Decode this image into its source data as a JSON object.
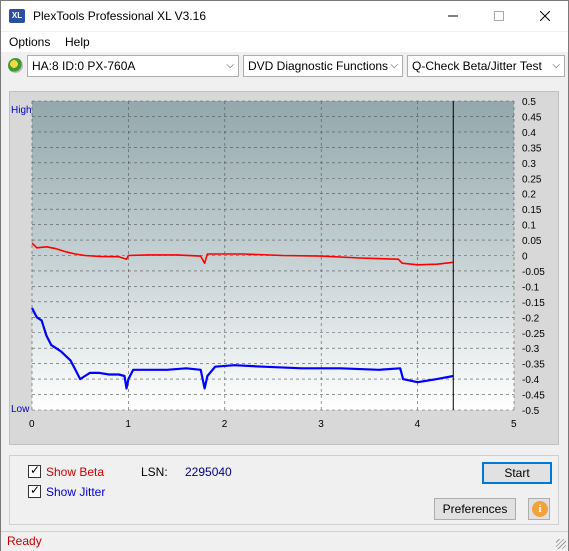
{
  "window": {
    "title": "PlexTools Professional XL V3.16",
    "icon_label": "XL",
    "minimize_icon": "minimize-icon",
    "maximize_icon": "maximize-icon",
    "close_icon": "close-icon"
  },
  "menu": {
    "options": "Options",
    "help": "Help"
  },
  "toolbar": {
    "drive": "HA:8 ID:0  PX-760A",
    "function": "DVD Diagnostic Functions",
    "test": "Q-Check Beta/Jitter Test"
  },
  "chart_data": {
    "type": "line",
    "title": "",
    "xlabel": "",
    "ylabel": "",
    "xlim": [
      0,
      5
    ],
    "ylim": [
      -0.5,
      0.5
    ],
    "x_ticks": [
      "0",
      "1",
      "2",
      "3",
      "4",
      "5"
    ],
    "y_ticks": [
      "0.5",
      "0.45",
      "0.4",
      "0.35",
      "0.3",
      "0.25",
      "0.2",
      "0.15",
      "0.1",
      "0.05",
      "0",
      "-0.05",
      "-0.1",
      "-0.15",
      "-0.2",
      "-0.25",
      "-0.3",
      "-0.35",
      "-0.4",
      "-0.45",
      "-0.5"
    ],
    "left_labels": {
      "top": "High",
      "bottom": "Low"
    },
    "grid": true,
    "end_marker_x": 4.37,
    "series": [
      {
        "color": "#ff0000",
        "points": [
          [
            0.0,
            0.04
          ],
          [
            0.05,
            0.025
          ],
          [
            0.15,
            0.028
          ],
          [
            0.25,
            0.022
          ],
          [
            0.35,
            0.012
          ],
          [
            0.45,
            0.005
          ],
          [
            0.55,
            0.0
          ],
          [
            0.7,
            -0.003
          ],
          [
            0.9,
            -0.004
          ],
          [
            0.98,
            -0.012
          ],
          [
            1.0,
            0.0
          ],
          [
            1.2,
            0.002
          ],
          [
            1.5,
            0.002
          ],
          [
            1.75,
            -0.002
          ],
          [
            1.79,
            -0.025
          ],
          [
            1.82,
            0.005
          ],
          [
            2.2,
            0.005
          ],
          [
            2.6,
            0.0
          ],
          [
            3.0,
            -0.002
          ],
          [
            3.4,
            -0.008
          ],
          [
            3.8,
            -0.012
          ],
          [
            3.84,
            -0.025
          ],
          [
            4.0,
            -0.03
          ],
          [
            4.2,
            -0.028
          ],
          [
            4.37,
            -0.022
          ]
        ]
      },
      {
        "color": "#0000ff",
        "points": [
          [
            0.0,
            -0.17
          ],
          [
            0.05,
            -0.2
          ],
          [
            0.1,
            -0.21
          ],
          [
            0.15,
            -0.26
          ],
          [
            0.2,
            -0.29
          ],
          [
            0.3,
            -0.31
          ],
          [
            0.4,
            -0.34
          ],
          [
            0.45,
            -0.37
          ],
          [
            0.5,
            -0.4
          ],
          [
            0.55,
            -0.39
          ],
          [
            0.6,
            -0.38
          ],
          [
            0.7,
            -0.38
          ],
          [
            0.8,
            -0.385
          ],
          [
            0.9,
            -0.385
          ],
          [
            0.96,
            -0.39
          ],
          [
            0.98,
            -0.43
          ],
          [
            1.0,
            -0.4
          ],
          [
            1.05,
            -0.37
          ],
          [
            1.2,
            -0.37
          ],
          [
            1.4,
            -0.37
          ],
          [
            1.6,
            -0.365
          ],
          [
            1.75,
            -0.37
          ],
          [
            1.79,
            -0.43
          ],
          [
            1.82,
            -0.39
          ],
          [
            1.9,
            -0.36
          ],
          [
            2.1,
            -0.355
          ],
          [
            2.4,
            -0.36
          ],
          [
            2.8,
            -0.365
          ],
          [
            3.2,
            -0.365
          ],
          [
            3.6,
            -0.37
          ],
          [
            3.82,
            -0.365
          ],
          [
            3.85,
            -0.4
          ],
          [
            4.0,
            -0.41
          ],
          [
            4.2,
            -0.4
          ],
          [
            4.37,
            -0.39
          ]
        ]
      }
    ]
  },
  "controls": {
    "show_beta": "Show Beta",
    "show_jitter": "Show Jitter",
    "lsn_label": "LSN:",
    "lsn_value": "2295040",
    "start": "Start",
    "preferences": "Preferences",
    "info_icon": "info-icon"
  },
  "status": {
    "text": "Ready"
  },
  "colors": {
    "beta": "#ff0000",
    "jitter": "#0000ff",
    "status_text": "#c00000",
    "accent": "#0078d7"
  }
}
